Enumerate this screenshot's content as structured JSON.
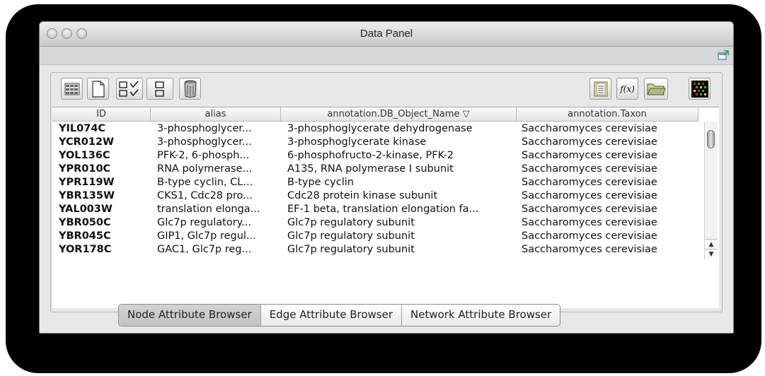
{
  "window": {
    "title": "Data Panel"
  },
  "toolbar": {
    "left_icons": [
      "select-attributes-icon",
      "new-attribute-icon",
      "select-all-icon",
      "deselect-all-icon",
      "delete-attribute-icon"
    ],
    "right_icons": [
      "import-table-icon",
      "function-icon",
      "open-folder-icon",
      "heatmap-icon"
    ],
    "function_label": "f(x)"
  },
  "table": {
    "columns": [
      "ID",
      "alias",
      "annotation.DB_Object_Name ▽",
      "annotation.Taxon"
    ],
    "rows": [
      [
        "YIL074C",
        "3-phosphoglycer...",
        "3-phosphoglycerate dehydrogenase",
        "Saccharomyces cerevisiae"
      ],
      [
        "YCR012W",
        "3-phosphoglycer...",
        "3-phosphoglycerate kinase",
        "Saccharomyces cerevisiae"
      ],
      [
        "YOL136C",
        "PFK-2, 6-phosph...",
        "6-phosphofructo-2-kinase, PFK-2",
        "Saccharomyces cerevisiae"
      ],
      [
        "YPR010C",
        "RNA polymerase...",
        "A135, RNA polymerase I subunit",
        "Saccharomyces cerevisiae"
      ],
      [
        "YPR119W",
        "B-type cyclin, CL...",
        "B-type cyclin",
        "Saccharomyces cerevisiae"
      ],
      [
        "YBR135W",
        "CKS1, Cdc28 pro...",
        "Cdc28 protein kinase subunit",
        "Saccharomyces cerevisiae"
      ],
      [
        "YAL003W",
        "translation elonga...",
        "EF-1 beta, translation elongation fa...",
        "Saccharomyces cerevisiae"
      ],
      [
        "YBR050C",
        "Glc7p regulatory...",
        "Glc7p regulatory subunit",
        "Saccharomyces cerevisiae"
      ],
      [
        "YBR045C",
        "GIP1, Glc7p regul...",
        "Glc7p regulatory subunit",
        "Saccharomyces cerevisiae"
      ],
      [
        "YOR178C",
        "GAC1, Glc7p reg...",
        "Glc7p regulatory subunit",
        "Saccharomyces cerevisiae"
      ]
    ]
  },
  "tabs": [
    {
      "label": "Node Attribute Browser",
      "active": true
    },
    {
      "label": "Edge Attribute Browser",
      "active": false
    },
    {
      "label": "Network Attribute Browser",
      "active": false
    }
  ],
  "scrollbar": {
    "up_arrow": "▲",
    "down_arrow": "▼"
  }
}
